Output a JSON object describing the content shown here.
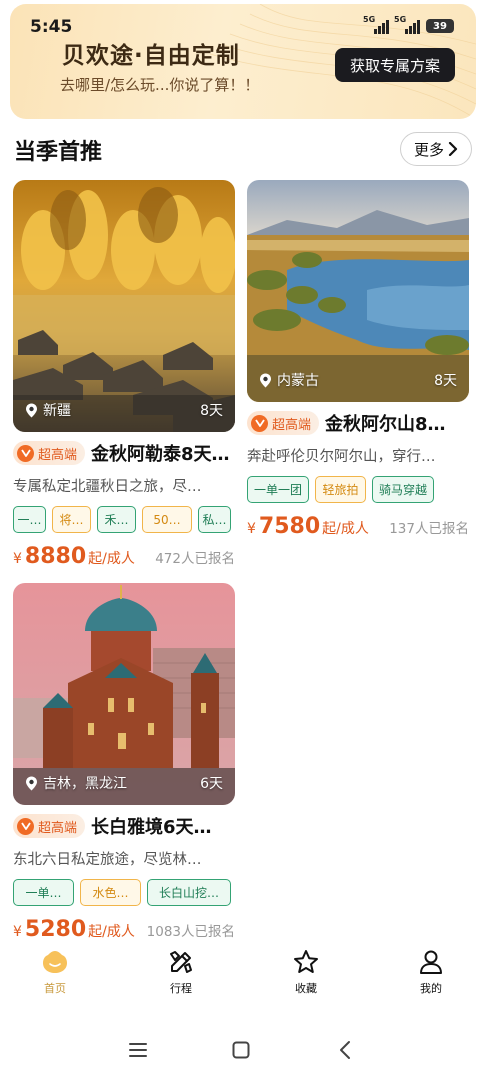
{
  "status": {
    "time": "5:45",
    "signal1": "5G",
    "signal2": "5G",
    "battery": "39"
  },
  "banner": {
    "title": "贝欢途·自由定制",
    "subtitle": "去哪里/怎么玩...你说了算！！",
    "cta": "获取专属方案"
  },
  "section": {
    "title": "当季首推",
    "more": "更多"
  },
  "cards": [
    {
      "location": "新疆",
      "days": "8天",
      "badge": "超高端",
      "title": "金秋阿勒泰8天…",
      "desc": "专属私定北疆秋日之旅，尽…",
      "tags": [
        "一…",
        "将…",
        "禾…",
        "50…",
        "私…"
      ],
      "currency": "¥",
      "price": "8880",
      "unit": "起/成人",
      "enrolled": "472人已报名"
    },
    {
      "location": "内蒙古",
      "days": "8天",
      "badge": "超高端",
      "title": "金秋阿尔山8…",
      "desc": "奔赴呼伦贝尔阿尔山，穿行…",
      "tags": [
        "一单一团",
        "轻旅拍",
        "骑马穿越"
      ],
      "currency": "¥",
      "price": "7580",
      "unit": "起/成人",
      "enrolled": "137人已报名"
    },
    {
      "location": "吉林，黑龙江",
      "days": "6天",
      "badge": "超高端",
      "title": "长白雅境6天…",
      "desc": "东北六日私定旅途，尽览林…",
      "tags": [
        "一单…",
        "水色…",
        "长白山挖…"
      ],
      "currency": "¥",
      "price": "5280",
      "unit": "起/成人",
      "enrolled": "1083人已报名"
    }
  ],
  "tabs": [
    {
      "label": "首页",
      "icon": "home-icon",
      "active": true
    },
    {
      "label": "行程",
      "icon": "itinerary-icon",
      "active": false
    },
    {
      "label": "收藏",
      "icon": "star-icon",
      "active": false
    },
    {
      "label": "我的",
      "icon": "profile-icon",
      "active": false
    }
  ],
  "colors": {
    "accent": "#e05a1e",
    "tagGreen": "#34a374",
    "tagOrange": "#f1b54a",
    "tabActive": "#c89a3e"
  }
}
